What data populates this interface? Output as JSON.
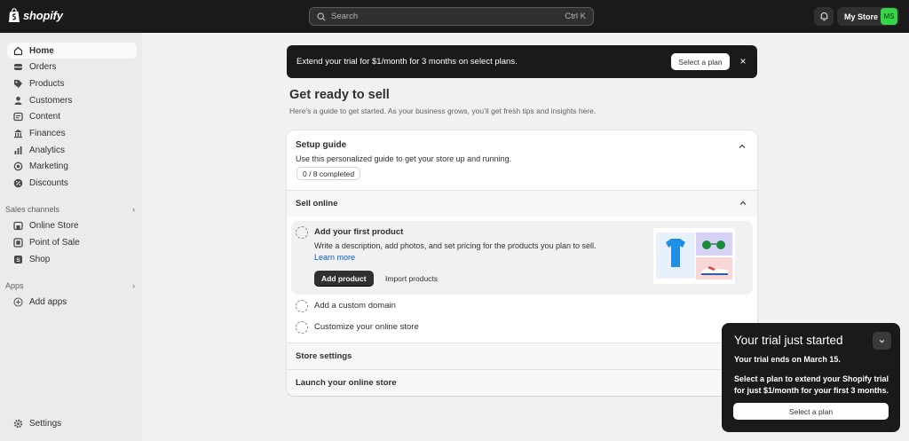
{
  "topbar": {
    "logo_text": "shopify",
    "search_placeholder": "Search",
    "search_shortcut": "Ctrl K",
    "store_name": "My Store",
    "avatar_initials": "MS"
  },
  "sidebar": {
    "items": [
      {
        "label": "Home",
        "icon": "home-icon"
      },
      {
        "label": "Orders",
        "icon": "orders-icon"
      },
      {
        "label": "Products",
        "icon": "tag-icon"
      },
      {
        "label": "Customers",
        "icon": "person-icon"
      },
      {
        "label": "Content",
        "icon": "content-icon"
      },
      {
        "label": "Finances",
        "icon": "bank-icon"
      },
      {
        "label": "Analytics",
        "icon": "bar-chart-icon"
      },
      {
        "label": "Marketing",
        "icon": "target-icon"
      },
      {
        "label": "Discounts",
        "icon": "discount-icon"
      }
    ],
    "sales_channels_label": "Sales channels",
    "channels": [
      {
        "label": "Online Store",
        "icon": "storefront-icon"
      },
      {
        "label": "Point of Sale",
        "icon": "pos-icon"
      },
      {
        "label": "Shop",
        "icon": "shop-bag-icon"
      }
    ],
    "apps_label": "Apps",
    "add_apps_label": "Add apps",
    "settings_label": "Settings"
  },
  "banner": {
    "text": "Extend your trial for $1/month for 3 months on select plans.",
    "button_label": "Select a plan",
    "close_glyph": "×"
  },
  "page": {
    "title": "Get ready to sell",
    "subtitle": "Here’s a guide to get started. As your business grows, you’ll get fresh tips and insights here."
  },
  "setup_guide": {
    "title": "Setup guide",
    "subtitle": "Use this personalized guide to get your store up and running.",
    "progress_text": "0 / 8 completed",
    "sell_online_label": "Sell online",
    "first_task": {
      "title": "Add your first product",
      "description": "Write a description, add photos, and set pricing for the products you plan to sell.",
      "link_label": "Learn more",
      "primary_button": "Add product",
      "secondary_button": "Import products"
    },
    "other_tasks": [
      "Add a custom domain",
      "Customize your online store"
    ],
    "store_settings_label": "Store settings",
    "launch_label": "Launch your online store"
  },
  "trial_popup": {
    "title": "Your trial just started",
    "ends_prefix": "Your trial ends on ",
    "ends_date": "March 15",
    "ends_suffix": ".",
    "body": "Select a plan to extend your Shopify trial for just $1/month for your first 3 months.",
    "button_label": "Select a plan"
  },
  "colors": {
    "topbar_bg": "#1a1a1a",
    "sidebar_bg": "#ebebeb",
    "page_bg": "#f1f1f1",
    "link": "#005bd3",
    "avatar_bg": "#36d44a"
  }
}
